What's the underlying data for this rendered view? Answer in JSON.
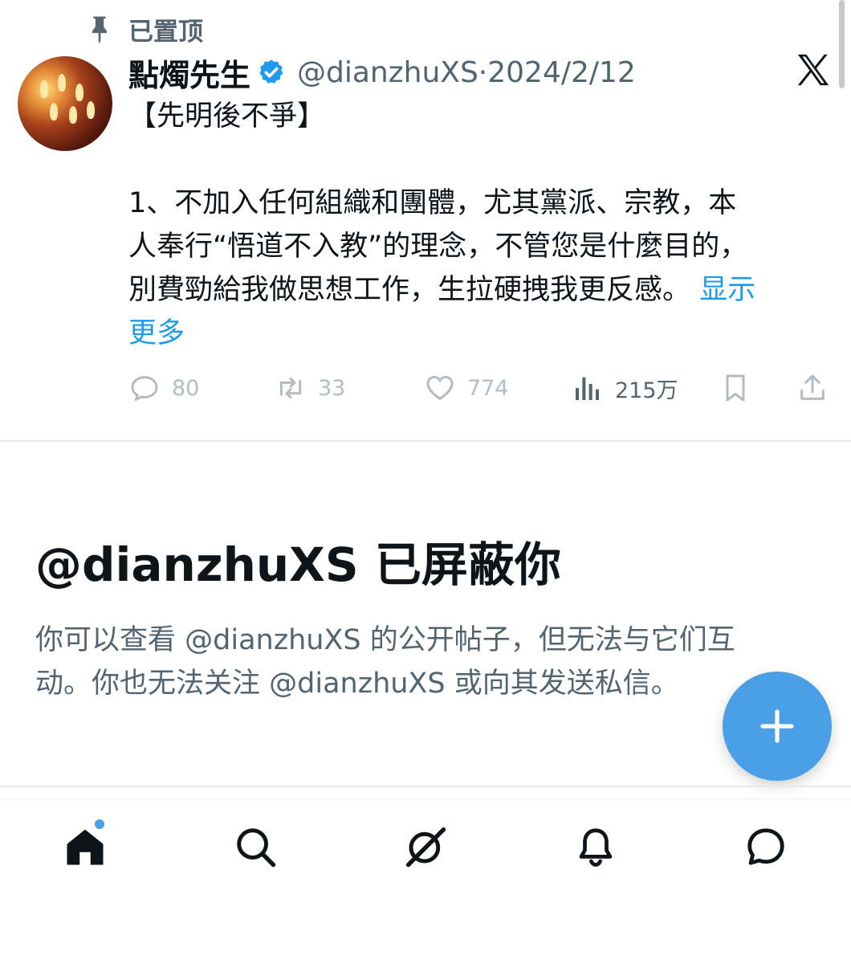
{
  "pinned": {
    "label": "已置顶",
    "icon": "pin-icon"
  },
  "tweet": {
    "author": {
      "display_name": "點燭先生",
      "verified": true,
      "handle": "@dianzhuXS",
      "separator": "·",
      "date": "2024/2/12"
    },
    "body_lines": [
      "【先明後不爭】",
      "1、不加入任何組織和團體，尤其黨派、宗教，本",
      "人奉行“悟道不入教”的理念，不管您是什麼目的，",
      "別費勁給我做思想工作，生拉硬拽我更反感。"
    ],
    "show_more_part1": "显示",
    "show_more_part2": "更多",
    "actions": {
      "reply_count": "80",
      "retweet_count": "33",
      "like_count": "774",
      "view_count": "215万"
    }
  },
  "blocked": {
    "title": "@dianzhuXS 已屏蔽你",
    "description_lines": [
      "你可以查看 @dianzhuXS 的公开帖子，但无法与它们互",
      "动。你也无法关注 @dianzhuXS 或向其发送私信。"
    ]
  },
  "nav": {
    "items": [
      "home-icon",
      "search-icon",
      "grok-icon",
      "bell-icon",
      "messages-icon"
    ],
    "home_has_notification": true
  },
  "colors": {
    "accent": "#1d9bf0",
    "fab": "#4b9fe6",
    "secondary_text": "#536471",
    "muted_icon": "#b4bcc2"
  }
}
